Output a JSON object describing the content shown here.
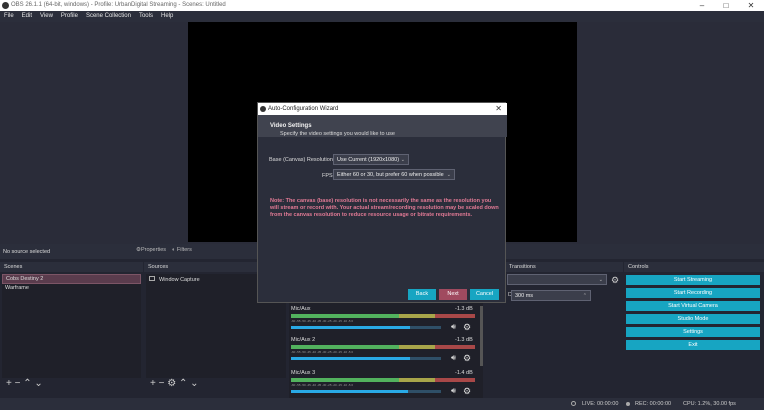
{
  "window": {
    "title": "OBS 26.1.1 (64-bit, windows) - Profile: UrbanDigital Streaming - Scenes: Untitled"
  },
  "menu": [
    "File",
    "Edit",
    "View",
    "Profile",
    "Scene Collection",
    "Tools",
    "Help"
  ],
  "source_toolbar": {
    "status": "No source selected",
    "properties": "Properties",
    "filters": "Filters"
  },
  "scenes": {
    "title": "Scenes",
    "items": [
      "Cobs Destiny 2",
      "Warframe"
    ],
    "selected": "Cobs Destiny 2"
  },
  "sources": {
    "title": "Sources",
    "items": [
      "Window Capture"
    ]
  },
  "transitions": {
    "title": "Transitions",
    "duration": "300 ms"
  },
  "controls": {
    "title": "Controls",
    "buttons": [
      "Start Streaming",
      "Start Recording",
      "Start Virtual Camera",
      "Studio Mode",
      "Settings",
      "Exit"
    ]
  },
  "mixer": {
    "channels": [
      {
        "name": "Mic/Aux",
        "db": "-1.3 dB",
        "level": 0.79
      },
      {
        "name": "Mic/Aux 2",
        "db": "-1.3 dB",
        "level": 0.79
      },
      {
        "name": "Mic/Aux 3",
        "db": "-1.4 dB",
        "level": 0.78
      }
    ],
    "ticks": "-60  -55  -50  -45  -40  -35  -30  -25  -20  -15  -10  -5  0"
  },
  "status": {
    "live": "LIVE: 00:00:00",
    "rec": "REC: 00:00:00",
    "cpu": "CPU: 1.2%, 30.00 fps"
  },
  "wizard": {
    "title": "Auto-Configuration Wizard",
    "heading": "Video Settings",
    "subheading": "Specify the video settings you would like to use",
    "resolution_label": "Base (Canvas) Resolution",
    "resolution_value": "Use Current (1920x1080)",
    "fps_label": "FPS",
    "fps_value": "Either 60 or 30, but prefer 60 when possible",
    "note": "Note: The canvas (base) resolution is not necessarily the same as the resolution you will stream or record with. Your actual stream/recording resolution may be scaled down from the canvas resolution to reduce resource usage or bitrate requirements.",
    "back": "Back",
    "next": "Next",
    "cancel": "Cancel"
  },
  "colors": {
    "accent": "#17a5c2",
    "note": "#e27a95",
    "next_button": "#a04a5f",
    "selected_scene": "#5a3c4d"
  }
}
